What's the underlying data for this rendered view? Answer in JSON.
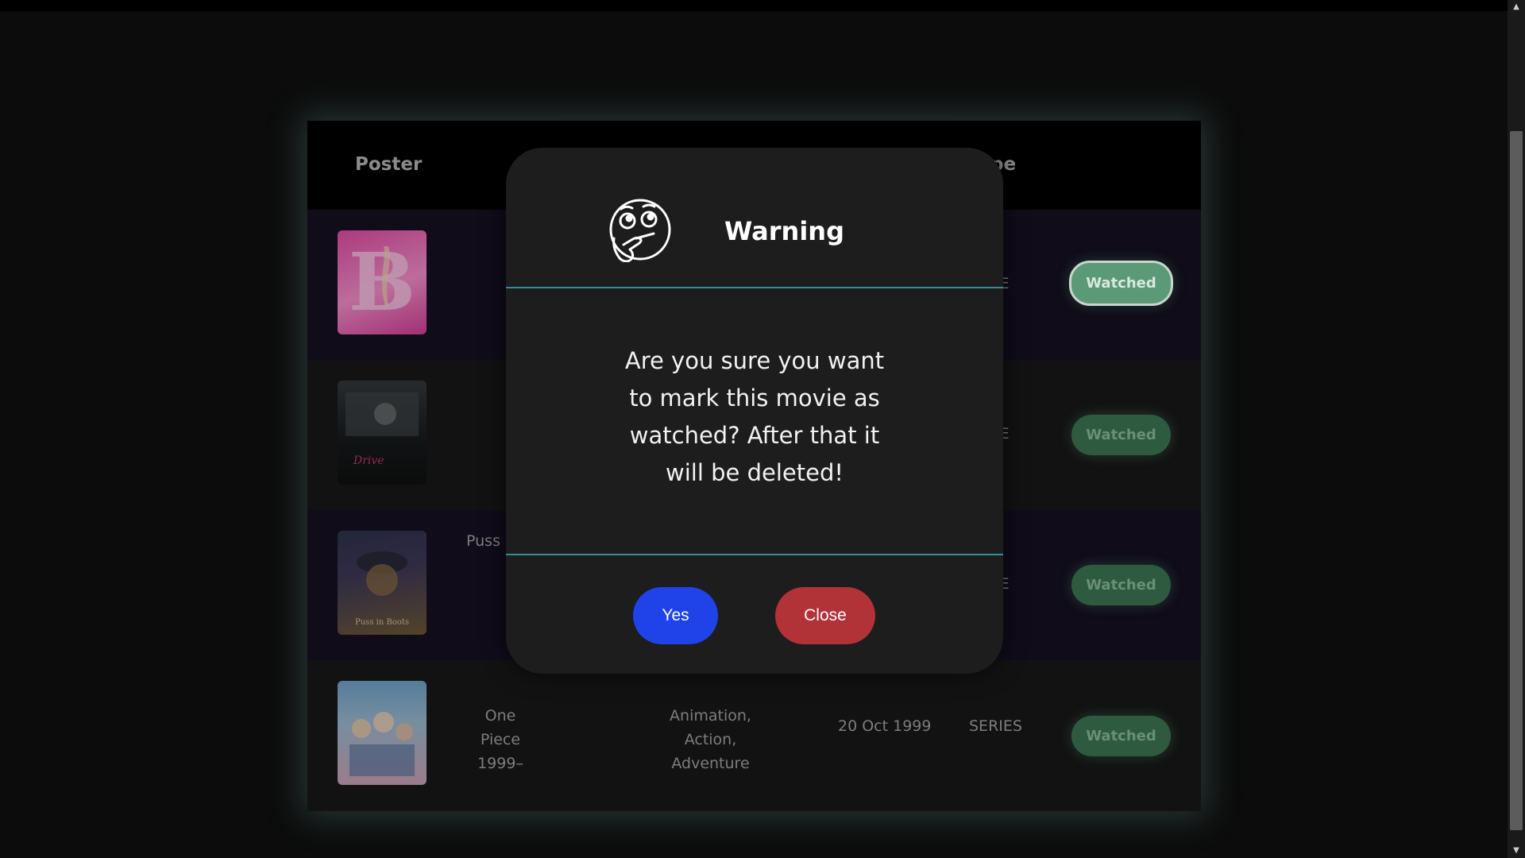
{
  "table": {
    "headers": {
      "poster": "Poster",
      "type_partial": "pe"
    },
    "rows": [
      {
        "title_partial": "",
        "type_partial": "IE",
        "button": "Watched",
        "poster_colors": [
          "#e24aa0",
          "#f58ec7"
        ]
      },
      {
        "title_partial": "",
        "type_partial": "IE",
        "button": "Watched",
        "poster_colors": [
          "#1a1f22",
          "#3a4045"
        ]
      },
      {
        "title_partial": "Puss i",
        "type_partial": "IE",
        "button": "Watched",
        "poster_colors": [
          "#2a2f45",
          "#6a5530"
        ]
      },
      {
        "title_line1": "One Piece",
        "title_line2": "1999–",
        "genre_line1": "Animation, Action,",
        "genre_line2": "Adventure",
        "date": "20 Oct 1999",
        "type": "SERIES",
        "button": "Watched",
        "poster_colors": [
          "#6aa0c8",
          "#c8a0b4"
        ]
      }
    ]
  },
  "modal": {
    "title": "Warning",
    "icon": "thinking-face-icon",
    "message": "Are you sure you want to mark this movie as watched? After that it will be deleted!",
    "yes_label": "Yes",
    "close_label": "Close",
    "divider_color": "#2f8f96",
    "yes_color": "#1f43e8",
    "close_color": "#b13237"
  }
}
